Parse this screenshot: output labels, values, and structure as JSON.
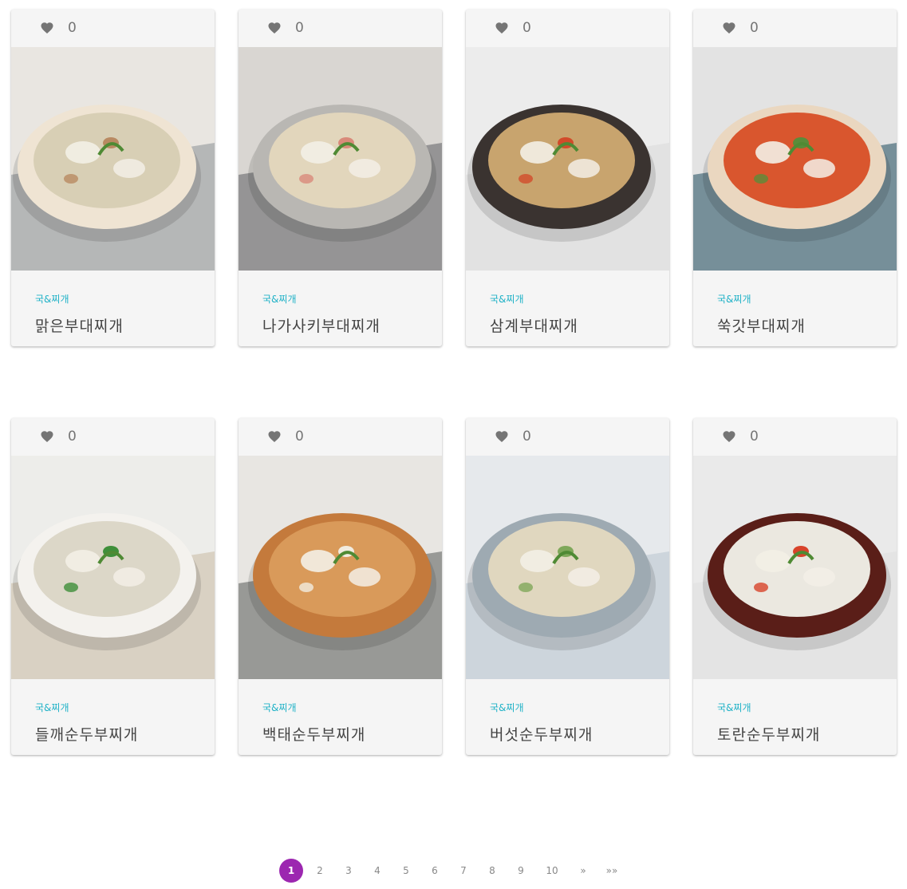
{
  "cards": [
    {
      "likes": "0",
      "category": "국&찌개",
      "title": "맑은부대찌개",
      "bg": "#e9e6e1",
      "cloth": "#8a8f95",
      "pot": "#efe4d3",
      "soup": "#d8cfb5",
      "accent": "#b98a62"
    },
    {
      "likes": "0",
      "category": "국&찌개",
      "title": "나가사키부대찌개",
      "bg": "#d9d6d2",
      "cloth": "#5d5f63",
      "pot": "#b9b7b3",
      "soup": "#e2d6bc",
      "accent": "#d98a7a"
    },
    {
      "likes": "0",
      "category": "국&찌개",
      "title": "삼계부대찌개",
      "bg": "#ececec",
      "cloth": "#dadada",
      "pot": "#3a3330",
      "soup": "#c8a46e",
      "accent": "#d24b2a"
    },
    {
      "likes": "0",
      "category": "국&찌개",
      "title": "쑥갓부대찌개",
      "bg": "#e3e3e3",
      "cloth": "#1e4a5c",
      "pot": "#ead7c0",
      "soup": "#d9562e",
      "accent": "#5a8c3a"
    },
    {
      "likes": "0",
      "category": "국&찌개",
      "title": "들깨순두부찌개",
      "bg": "#ededea",
      "cloth": "#c8b9a3",
      "pot": "#f4f2ee",
      "soup": "#dcd7c8",
      "accent": "#3f8f3a"
    },
    {
      "likes": "0",
      "category": "국&찌개",
      "title": "백태순두부찌개",
      "bg": "#e8e6e2",
      "cloth": "#555a57",
      "pot": "#c47a3c",
      "soup": "#d99a5a",
      "accent": "#f1ece0"
    },
    {
      "likes": "0",
      "category": "국&찌개",
      "title": "버섯순두부찌개",
      "bg": "#e6e9ec",
      "cloth": "#b8c4cf",
      "pot": "#9eaab2",
      "soup": "#e0d7bf",
      "accent": "#7fa85a"
    },
    {
      "likes": "0",
      "category": "국&찌개",
      "title": "토란순두부찌개",
      "bg": "#eaeaea",
      "cloth": "#dedede",
      "pot": "#5a1e18",
      "soup": "#ebe8e0",
      "accent": "#d8432a"
    }
  ],
  "pagination": {
    "pages": [
      "1",
      "2",
      "3",
      "4",
      "5",
      "6",
      "7",
      "8",
      "9",
      "10"
    ],
    "current": "1",
    "next_label": "»",
    "last_label": "»»"
  },
  "colors": {
    "accent_purple": "#9c27b0",
    "category_teal": "#20b2c7",
    "heart_gray": "#757575"
  }
}
